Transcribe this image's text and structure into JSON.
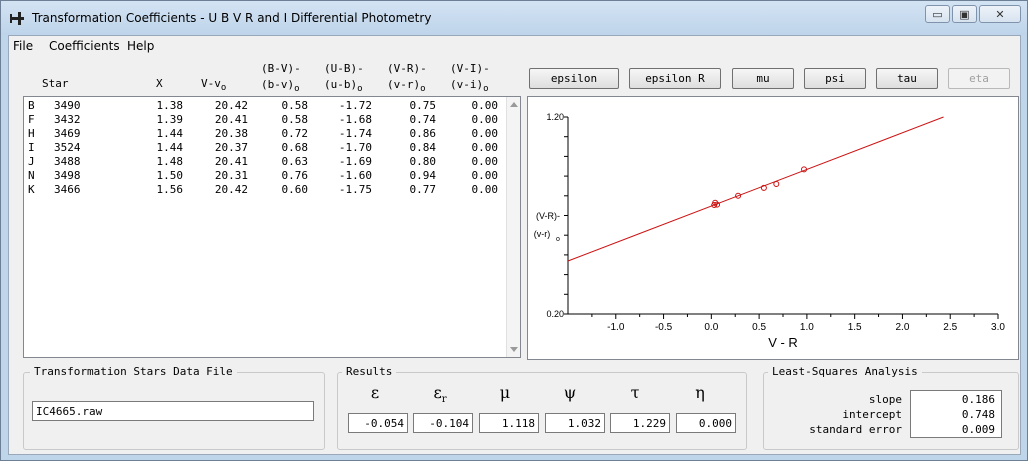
{
  "window": {
    "title": "Transformation Coefficients - U B V R and I Differential Photometry",
    "buttons": {
      "minimize": "▭",
      "maximize": "▣",
      "close": "✕"
    }
  },
  "menu": [
    "File",
    "Coefficients",
    "Help"
  ],
  "table": {
    "headers": {
      "star": "Star",
      "x": "X",
      "vv": "V-v",
      "vv_sub": "o",
      "bv_top": "(B-V)-",
      "bv_bot": "(b-v)",
      "ub_top": "(U-B)-",
      "ub_bot": "(u-b)",
      "vr_top": "(V-R)-",
      "vr_bot": "(v-r)",
      "vi_top": "(V-I)-",
      "vi_bot": "(v-i)",
      "sub": "o"
    },
    "rows": [
      [
        "B",
        "3490",
        "1.38",
        "20.42",
        "0.58",
        "-1.72",
        "0.75",
        "0.00"
      ],
      [
        "F",
        "3432",
        "1.39",
        "20.41",
        "0.58",
        "-1.68",
        "0.74",
        "0.00"
      ],
      [
        "H",
        "3469",
        "1.44",
        "20.38",
        "0.72",
        "-1.74",
        "0.86",
        "0.00"
      ],
      [
        "I",
        "3524",
        "1.44",
        "20.37",
        "0.68",
        "-1.70",
        "0.84",
        "0.00"
      ],
      [
        "J",
        "3488",
        "1.48",
        "20.41",
        "0.63",
        "-1.69",
        "0.80",
        "0.00"
      ],
      [
        "N",
        "3498",
        "1.50",
        "20.31",
        "0.76",
        "-1.60",
        "0.94",
        "0.00"
      ],
      [
        "K",
        "3466",
        "1.56",
        "20.42",
        "0.60",
        "-1.75",
        "0.77",
        "0.00"
      ]
    ]
  },
  "coef_buttons": [
    "epsilon",
    "epsilon R",
    "mu",
    "psi",
    "tau",
    "eta"
  ],
  "chart_data": {
    "type": "scatter",
    "xlabel": "V - R",
    "ylabel_top": "(V-R)-",
    "ylabel_bot": "(v-r)",
    "ylabel_sub": "o",
    "xlim": [
      -1.5,
      3.0
    ],
    "ylim": [
      0.2,
      1.2
    ],
    "xticks": [
      "-1.0",
      "-0.5",
      "0.0",
      "0.5",
      "1.0",
      "1.5",
      "2.0",
      "2.5",
      "3.0"
    ],
    "yticks": [
      "1.20",
      "0.20"
    ],
    "points": [
      {
        "x": 0.03,
        "y": 0.753
      },
      {
        "x": 0.04,
        "y": 0.765
      },
      {
        "x": 0.06,
        "y": 0.755
      },
      {
        "x": 0.28,
        "y": 0.8
      },
      {
        "x": 0.55,
        "y": 0.84
      },
      {
        "x": 0.68,
        "y": 0.86
      },
      {
        "x": 0.97,
        "y": 0.934
      }
    ],
    "fit": {
      "slope": 0.186,
      "intercept": 0.748
    },
    "colors": {
      "line": "#cc1111",
      "points": "#cc1111"
    }
  },
  "file_group": {
    "label": "Transformation Stars Data File",
    "value": "IC4665.raw"
  },
  "results": {
    "label": "Results",
    "symbols": [
      "ε",
      "ε",
      "μ",
      "ψ",
      "τ",
      "η"
    ],
    "eps_r_sub": "r",
    "values": [
      "-0.054",
      "-0.104",
      "1.118",
      "1.032",
      "1.229",
      "0.000"
    ]
  },
  "least_squares": {
    "label": "Least-Squares Analysis",
    "labels": [
      "slope",
      "intercept",
      "standard error"
    ],
    "values": [
      "0.186",
      "0.748",
      "0.009"
    ]
  }
}
